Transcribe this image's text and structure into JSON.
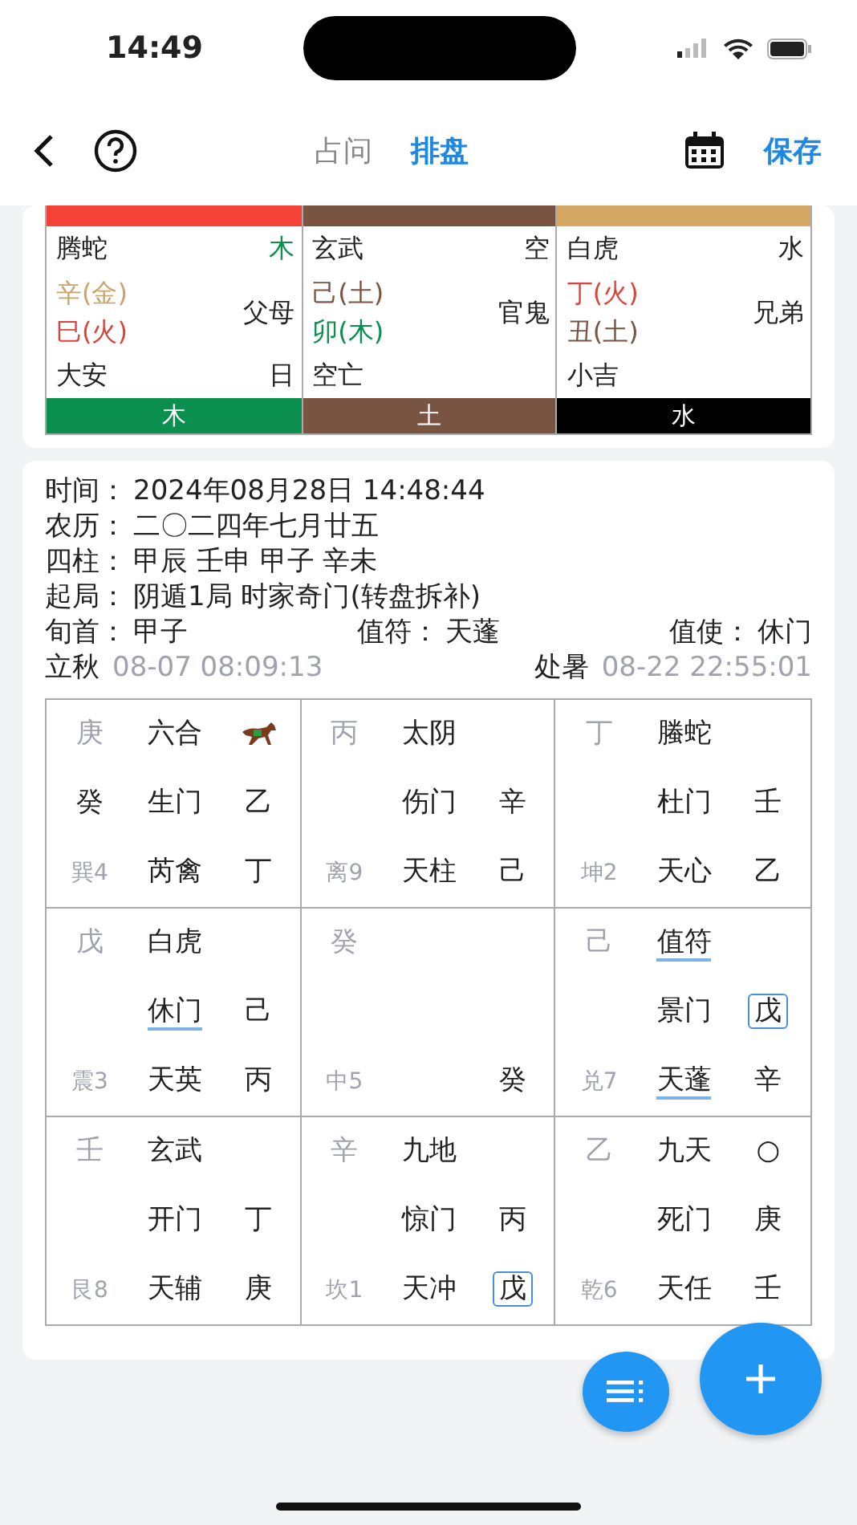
{
  "status_bar": {
    "time": "14:49"
  },
  "nav": {
    "tabs": [
      {
        "label": "占问",
        "selected": false
      },
      {
        "label": "排盘",
        "selected": true
      }
    ],
    "save": "保存"
  },
  "wuxing_table": {
    "columns": [
      {
        "top_bar": {
          "color": "#f44336"
        },
        "bottom_bar": {
          "label": "木",
          "color": "#0b8f4f"
        },
        "god": "腾蛇",
        "corner": {
          "text": "木",
          "color": "#0b8f4f"
        },
        "lines": [
          {
            "text": "辛(金)",
            "color": "#c9a46a"
          },
          {
            "text": "巳(火)",
            "color": "#d9453b"
          }
        ],
        "relation": "父母",
        "foot": "大安",
        "foot_right": "日"
      },
      {
        "top_bar": {
          "color": "#7a5443"
        },
        "bottom_bar": {
          "label": "土",
          "color": "#7a5443"
        },
        "god": "玄武",
        "corner": {
          "text": "空",
          "color": "#222222"
        },
        "lines": [
          {
            "text": "己(土)",
            "color": "#7a5443"
          },
          {
            "text": "卯(木)",
            "color": "#0b8f4f"
          }
        ],
        "relation": "官鬼",
        "foot": "空亡"
      },
      {
        "top_bar": {
          "color": "#d4a862"
        },
        "bottom_bar": {
          "label": "水",
          "color": "#000000"
        },
        "god": "白虎",
        "corner": {
          "text": "水",
          "color": "#222222"
        },
        "lines": [
          {
            "text": "丁(火)",
            "color": "#d9453b"
          },
          {
            "text": "丑(土)",
            "color": "#7a5443"
          }
        ],
        "relation": "兄弟",
        "foot": "小吉"
      }
    ]
  },
  "info": [
    [
      {
        "kind": "field",
        "label": "时间：",
        "value": "2024年08月28日 14:48:44"
      }
    ],
    [
      {
        "kind": "field",
        "label": "农历：",
        "value": "二〇二四年七月廿五"
      }
    ],
    [
      {
        "kind": "field",
        "label": "四柱：",
        "value": "甲辰 壬申 甲子 辛未"
      }
    ],
    [
      {
        "kind": "field",
        "label": "起局：",
        "value": "阴遁1局 时家奇门(转盘拆补)"
      }
    ],
    [
      {
        "kind": "field",
        "label": "旬首：",
        "value": "甲子"
      },
      {
        "kind": "field",
        "label": "值符：",
        "value": "天蓬"
      },
      {
        "kind": "field",
        "label": "值使：",
        "value": "休门"
      }
    ],
    [
      {
        "kind": "term",
        "label": "立秋",
        "value": "08-07 08:09:13"
      },
      {
        "kind": "term",
        "label": "处暑",
        "value": "08-22 22:55:01"
      }
    ]
  ],
  "grid": {
    "cells": [
      {
        "stem": "庚",
        "god": "六合",
        "extra": {
          "kind": "horse"
        },
        "hidden": "癸",
        "door": "生门",
        "door_stem": "乙",
        "palace": "巽4",
        "star": "芮禽",
        "star_stem": "丁"
      },
      {
        "stem": "丙",
        "god": "太阴",
        "door": "伤门",
        "door_stem": "辛",
        "palace": "离9",
        "star": "天柱",
        "star_stem": "己"
      },
      {
        "stem": "丁",
        "god": "螣蛇",
        "door": "杜门",
        "door_stem": "壬",
        "palace": "坤2",
        "star": "天心",
        "star_stem": "乙"
      },
      {
        "stem": "戊",
        "god": "白虎",
        "door": {
          "text": "休门",
          "underlined": true
        },
        "door_stem": "己",
        "palace": "震3",
        "star": "天英",
        "star_stem": "丙"
      },
      {
        "stem": "癸",
        "palace": "中5",
        "star_stem": "癸"
      },
      {
        "stem": "己",
        "god": {
          "text": "值符",
          "underlined": true
        },
        "door": "景门",
        "door_stem": {
          "text": "戊",
          "boxed": true
        },
        "palace": "兑7",
        "star": {
          "text": "天蓬",
          "underlined": true
        },
        "star_stem": "辛"
      },
      {
        "stem": "壬",
        "god": "玄武",
        "door": "开门",
        "door_stem": "丁",
        "palace": "艮8",
        "star": "天辅",
        "star_stem": "庚"
      },
      {
        "stem": "辛",
        "god": "九地",
        "door": "惊门",
        "door_stem": "丙",
        "palace": "坎1",
        "star": "天冲",
        "star_stem": {
          "text": "戊",
          "boxed": true
        }
      },
      {
        "stem": "乙",
        "god": "九天",
        "extra": "○",
        "door": "死门",
        "door_stem": "庚",
        "palace": "乾6",
        "star": "天任",
        "star_stem": "壬"
      }
    ]
  }
}
